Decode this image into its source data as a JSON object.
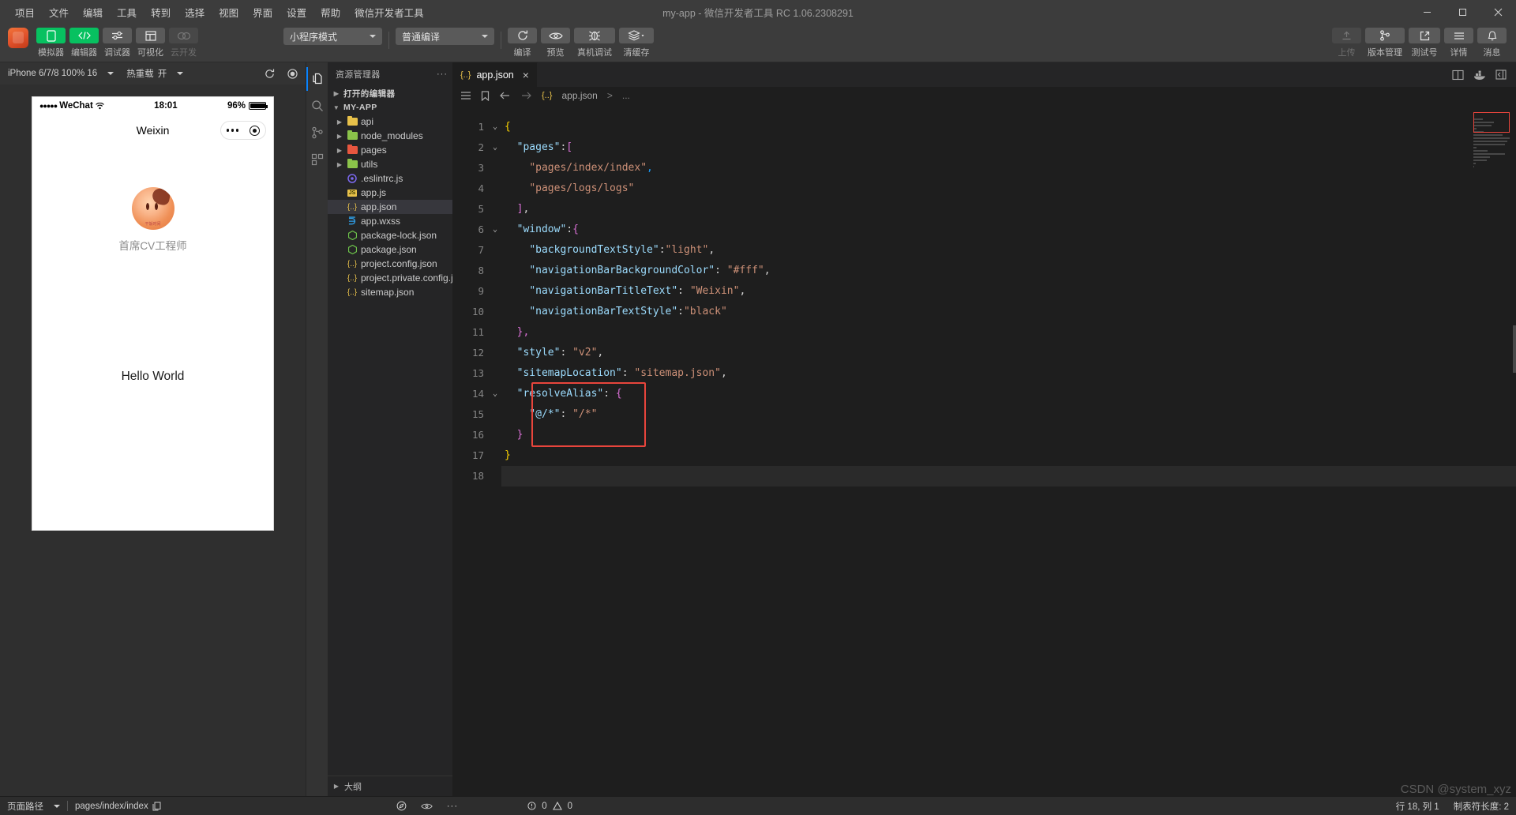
{
  "window": {
    "title": "my-app - 微信开发者工具 RC 1.06.2308291",
    "minimize": "minimize-icon",
    "maximize": "maximize-icon",
    "close": "close-icon"
  },
  "menu": {
    "items": [
      {
        "label": "项目"
      },
      {
        "label": "文件"
      },
      {
        "label": "编辑"
      },
      {
        "label": "工具"
      },
      {
        "label": "转到"
      },
      {
        "label": "选择"
      },
      {
        "label": "视图"
      },
      {
        "label": "界面"
      },
      {
        "label": "设置"
      },
      {
        "label": "帮助"
      },
      {
        "label": "微信开发者工具"
      }
    ]
  },
  "toolbar": {
    "left_buttons": [
      {
        "label": "模拟器",
        "icon": "phone-icon",
        "state": "active"
      },
      {
        "label": "编辑器",
        "icon": "code-icon",
        "state": "active"
      },
      {
        "label": "调试器",
        "icon": "sliders-icon",
        "state": "normal"
      },
      {
        "label": "可视化",
        "icon": "layout-icon",
        "state": "normal"
      },
      {
        "label": "云开发",
        "icon": "cloud-icon",
        "state": "disabled"
      }
    ],
    "mode_select": "小程序模式",
    "compile_select": "普通编译",
    "action_buttons": [
      {
        "label": "编译",
        "icon": "refresh-icon"
      },
      {
        "label": "预览",
        "icon": "eye-icon"
      },
      {
        "label": "真机调试",
        "icon": "bug-icon"
      },
      {
        "label": "清缓存",
        "icon": "layers-icon"
      }
    ],
    "right_buttons": [
      {
        "label": "上传",
        "icon": "upload-icon",
        "state": "disabled"
      },
      {
        "label": "版本管理",
        "icon": "branch-icon",
        "state": "normal"
      },
      {
        "label": "测试号",
        "icon": "external-link-icon",
        "state": "normal"
      },
      {
        "label": "详情",
        "icon": "menu-icon",
        "state": "normal"
      },
      {
        "label": "消息",
        "icon": "bell-icon",
        "state": "normal"
      }
    ]
  },
  "simulator": {
    "device": "iPhone 6/7/8 100% 16",
    "hot_reload_label": "热重载",
    "hot_reload_value": "开",
    "refresh_icon": "refresh-icon",
    "record_icon": "record-icon",
    "phone": {
      "carrier": "WeChat",
      "signal_dots": "●●●●●",
      "wifi_icon": "wifi-icon",
      "time": "18:01",
      "battery": "96%",
      "nav_title": "Weixin",
      "capsule_more_icon": "more-dots-icon",
      "capsule_target_icon": "target-icon",
      "avatar_watermark": "干饭时间",
      "avatar_caption": "首席CV工程师",
      "content_text": "Hello World"
    }
  },
  "activity_bar": {
    "items": [
      {
        "name": "explorer-icon",
        "active": true
      },
      {
        "name": "search-icon",
        "active": false
      },
      {
        "name": "source-control-icon",
        "active": false
      },
      {
        "name": "extensions-icon",
        "active": false
      },
      {
        "name": "split-editor-icon",
        "active": false
      },
      {
        "name": "docker-icon",
        "active": false
      },
      {
        "name": "collapse-panel-icon",
        "active": false
      }
    ]
  },
  "explorer": {
    "title": "资源管理器",
    "more_icon": "ellipsis-icon",
    "sections": [
      {
        "label": "打开的编辑器",
        "expanded": false
      },
      {
        "label": "MY-APP",
        "expanded": true
      }
    ],
    "files": [
      {
        "label": "api",
        "type": "folder",
        "color": "#e8c14a",
        "expandable": true,
        "selected": false
      },
      {
        "label": "node_modules",
        "type": "folder",
        "color": "#8bc34a",
        "expandable": true,
        "selected": false
      },
      {
        "label": "pages",
        "type": "folder",
        "color": "#e8563f",
        "expandable": true,
        "selected": false
      },
      {
        "label": "utils",
        "type": "folder",
        "color": "#8bc34a",
        "expandable": true,
        "selected": false
      },
      {
        "label": ".eslintrc.js",
        "type": "eslint",
        "color": "#7b68ee",
        "expandable": false,
        "selected": false
      },
      {
        "label": "app.js",
        "type": "js",
        "color": "#e8c14a",
        "expandable": false,
        "selected": false
      },
      {
        "label": "app.json",
        "type": "json",
        "color": "#e8c14a",
        "expandable": false,
        "selected": true
      },
      {
        "label": "app.wxss",
        "type": "css",
        "color": "#2f9fe8",
        "expandable": false,
        "selected": false
      },
      {
        "label": "package-lock.json",
        "type": "node",
        "color": "#6cc24a",
        "expandable": false,
        "selected": false
      },
      {
        "label": "package.json",
        "type": "node",
        "color": "#6cc24a",
        "expandable": false,
        "selected": false
      },
      {
        "label": "project.config.json",
        "type": "json",
        "color": "#e8c14a",
        "expandable": false,
        "selected": false
      },
      {
        "label": "project.private.config.json",
        "type": "json",
        "color": "#e8c14a",
        "expandable": false,
        "selected": false
      },
      {
        "label": "sitemap.json",
        "type": "json",
        "color": "#e8c14a",
        "expandable": false,
        "selected": false
      }
    ],
    "footer": {
      "label": "大纲",
      "icon": "chevron-right-icon"
    }
  },
  "editor": {
    "tab": {
      "label": "app.json",
      "icon": "json-icon",
      "close": "×"
    },
    "actions": [
      "split-editor-icon",
      "layout-icon",
      "ellipsis-icon"
    ],
    "breadcrumb": {
      "list_icon": "outline-icon",
      "bookmark_icon": "bookmark-icon",
      "back_icon": "arrow-left-icon",
      "forward_icon": "arrow-right-icon",
      "file": "app.json",
      "separator": ">",
      "tail": "..."
    },
    "lines": [
      {
        "n": 1,
        "fold": "v",
        "segs": [
          {
            "t": "{",
            "c": "br2"
          }
        ]
      },
      {
        "n": 2,
        "fold": "v",
        "segs": [
          {
            "t": "  ",
            "c": "p"
          },
          {
            "t": "\"pages\"",
            "c": "k"
          },
          {
            "t": ":",
            "c": "p"
          },
          {
            "t": "[",
            "c": "br"
          }
        ]
      },
      {
        "n": 3,
        "fold": "",
        "segs": [
          {
            "t": "    ",
            "c": "p"
          },
          {
            "t": "\"pages/index/index\"",
            "c": "s"
          },
          {
            "t": ",",
            "c": "br3"
          }
        ]
      },
      {
        "n": 4,
        "fold": "",
        "segs": [
          {
            "t": "    ",
            "c": "p"
          },
          {
            "t": "\"pages/logs/logs\"",
            "c": "s"
          }
        ]
      },
      {
        "n": 5,
        "fold": "",
        "segs": [
          {
            "t": "  ",
            "c": "p"
          },
          {
            "t": "]",
            "c": "br"
          },
          {
            "t": ",",
            "c": "p"
          }
        ]
      },
      {
        "n": 6,
        "fold": "v",
        "segs": [
          {
            "t": "  ",
            "c": "p"
          },
          {
            "t": "\"window\"",
            "c": "k"
          },
          {
            "t": ":",
            "c": "p"
          },
          {
            "t": "{",
            "c": "br"
          }
        ]
      },
      {
        "n": 7,
        "fold": "",
        "segs": [
          {
            "t": "    ",
            "c": "p"
          },
          {
            "t": "\"backgroundTextStyle\"",
            "c": "k"
          },
          {
            "t": ":",
            "c": "p"
          },
          {
            "t": "\"light\"",
            "c": "s"
          },
          {
            "t": ",",
            "c": "p"
          }
        ]
      },
      {
        "n": 8,
        "fold": "",
        "segs": [
          {
            "t": "    ",
            "c": "p"
          },
          {
            "t": "\"navigationBarBackgroundColor\"",
            "c": "k"
          },
          {
            "t": ": ",
            "c": "p"
          },
          {
            "t": "\"#fff\"",
            "c": "s"
          },
          {
            "t": ",",
            "c": "p"
          }
        ]
      },
      {
        "n": 9,
        "fold": "",
        "segs": [
          {
            "t": "    ",
            "c": "p"
          },
          {
            "t": "\"navigationBarTitleText\"",
            "c": "k"
          },
          {
            "t": ": ",
            "c": "p"
          },
          {
            "t": "\"Weixin\"",
            "c": "s"
          },
          {
            "t": ",",
            "c": "p"
          }
        ]
      },
      {
        "n": 10,
        "fold": "",
        "segs": [
          {
            "t": "    ",
            "c": "p"
          },
          {
            "t": "\"navigationBarTextStyle\"",
            "c": "k"
          },
          {
            "t": ":",
            "c": "p"
          },
          {
            "t": "\"black\"",
            "c": "s"
          }
        ]
      },
      {
        "n": 11,
        "fold": "",
        "segs": [
          {
            "t": "  ",
            "c": "p"
          },
          {
            "t": "}",
            "c": "br"
          },
          {
            "t": ",",
            "c": "br"
          }
        ]
      },
      {
        "n": 12,
        "fold": "",
        "segs": [
          {
            "t": "  ",
            "c": "p"
          },
          {
            "t": "\"style\"",
            "c": "k"
          },
          {
            "t": ": ",
            "c": "p"
          },
          {
            "t": "\"v2\"",
            "c": "s"
          },
          {
            "t": ",",
            "c": "p"
          }
        ]
      },
      {
        "n": 13,
        "fold": "",
        "segs": [
          {
            "t": "  ",
            "c": "p"
          },
          {
            "t": "\"sitemapLocation\"",
            "c": "k"
          },
          {
            "t": ": ",
            "c": "p"
          },
          {
            "t": "\"sitemap.json\"",
            "c": "s"
          },
          {
            "t": ",",
            "c": "p"
          }
        ]
      },
      {
        "n": 14,
        "fold": "v",
        "segs": [
          {
            "t": "  ",
            "c": "p"
          },
          {
            "t": "\"resolveAlias\"",
            "c": "k"
          },
          {
            "t": ": ",
            "c": "p"
          },
          {
            "t": "{",
            "c": "br"
          }
        ]
      },
      {
        "n": 15,
        "fold": "",
        "segs": [
          {
            "t": "    ",
            "c": "p"
          },
          {
            "t": "\"@/*\"",
            "c": "k"
          },
          {
            "t": ": ",
            "c": "p"
          },
          {
            "t": "\"/*\"",
            "c": "s"
          }
        ]
      },
      {
        "n": 16,
        "fold": "",
        "segs": [
          {
            "t": "  ",
            "c": "p"
          },
          {
            "t": "}",
            "c": "br"
          }
        ]
      },
      {
        "n": 17,
        "fold": "",
        "segs": [
          {
            "t": "}",
            "c": "br2"
          }
        ]
      },
      {
        "n": 18,
        "fold": "",
        "segs": [],
        "current": true
      }
    ],
    "highlight": {
      "from_line": 14,
      "to_line": 16,
      "color": "#e8453c"
    }
  },
  "status_bar": {
    "page_path_label": "页面路径",
    "page_path_value": "pages/index/index",
    "copy_icon": "copy-icon",
    "center_icons": [
      "compass-icon",
      "eye-icon",
      "ellipsis-icon"
    ],
    "problems": {
      "error_icon": "error-icon",
      "errors": "0",
      "warning_icon": "warning-icon",
      "warnings": "0"
    },
    "cursor": "行 18, 列 1",
    "indentation": "制表符长度: 2",
    "watermark": "CSDN @system_xyz",
    "watermark_small": "制表符长度: 2"
  }
}
